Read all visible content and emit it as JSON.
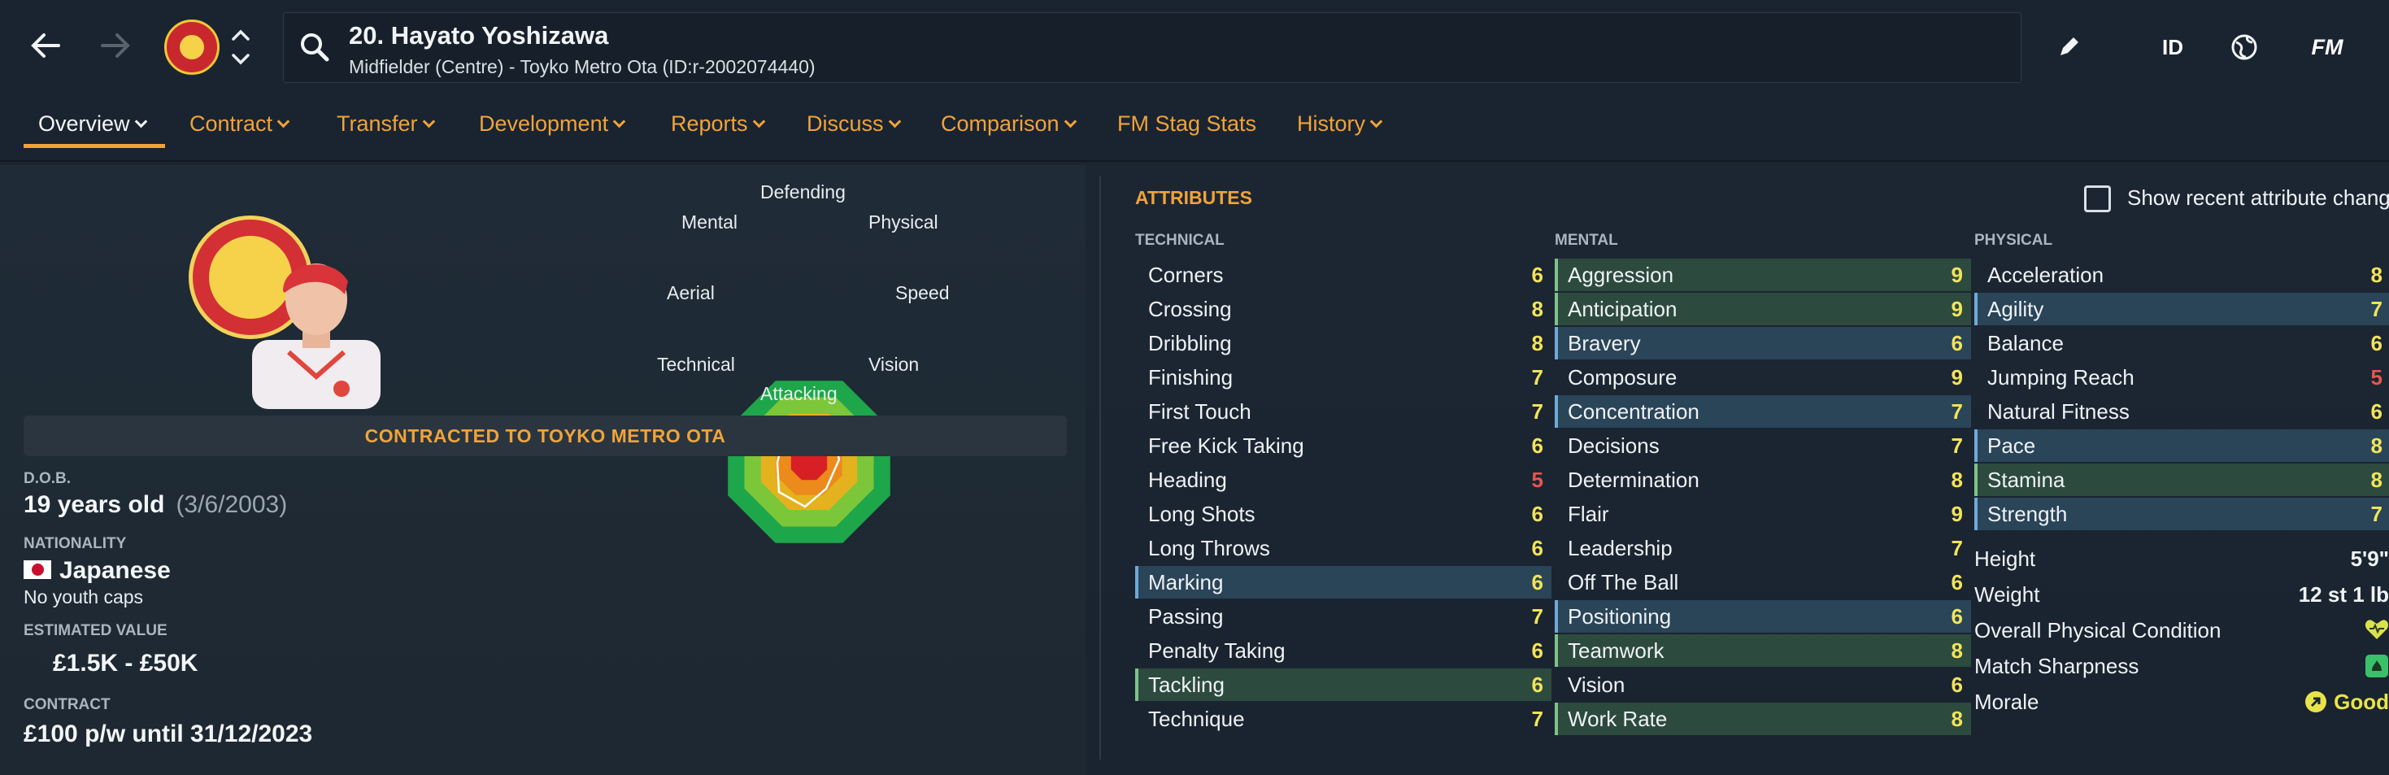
{
  "header": {
    "player_name": "20. Hayato Yoshizawa",
    "player_subtitle": "Midfielder (Centre) - Toyko Metro Ota (ID:r-2002074440)",
    "icon_id": "ID",
    "icon_fm": "FM"
  },
  "tabs": [
    {
      "label": "Overview"
    },
    {
      "label": "Contract"
    },
    {
      "label": "Transfer"
    },
    {
      "label": "Development"
    },
    {
      "label": "Reports"
    },
    {
      "label": "Discuss"
    },
    {
      "label": "Comparison"
    },
    {
      "label": "FM Stag Stats"
    },
    {
      "label": "History"
    }
  ],
  "profile": {
    "contracted_banner": "CONTRACTED TO TOYKO METRO OTA",
    "dob_label": "D.O.B.",
    "age": "19 years old",
    "dob": "(3/6/2003)",
    "nationality_label": "NATIONALITY",
    "nationality": "Japanese",
    "youth_caps": "No youth caps",
    "value_label": "ESTIMATED VALUE",
    "value": "£1.5K - £50K",
    "contract_label": "CONTRACT",
    "contract": "£100 p/w until 31/12/2023"
  },
  "polygon": {
    "labels": {
      "defending": "Defending",
      "physical": "Physical",
      "speed": "Speed",
      "vision": "Vision",
      "attacking": "Attacking",
      "technical": "Technical",
      "aerial": "Aerial",
      "mental": "Mental"
    },
    "ring_colors": [
      "#1ea64a",
      "#7cc63a",
      "#e4b21e",
      "#ec8a1c",
      "#d81f26"
    ]
  },
  "attributes": {
    "title": "ATTRIBUTES",
    "show_recent_label": "Show recent attribute changes",
    "technical_label": "TECHNICAL",
    "mental_label": "MENTAL",
    "physical_label": "PHYSICAL",
    "technical": [
      {
        "name": "Corners",
        "value": "6",
        "hl": ""
      },
      {
        "name": "Crossing",
        "value": "8",
        "hl": ""
      },
      {
        "name": "Dribbling",
        "value": "8",
        "hl": ""
      },
      {
        "name": "Finishing",
        "value": "7",
        "hl": ""
      },
      {
        "name": "First Touch",
        "value": "7",
        "hl": ""
      },
      {
        "name": "Free Kick Taking",
        "value": "6",
        "hl": ""
      },
      {
        "name": "Heading",
        "value": "5",
        "hl": ""
      },
      {
        "name": "Long Shots",
        "value": "6",
        "hl": ""
      },
      {
        "name": "Long Throws",
        "value": "6",
        "hl": ""
      },
      {
        "name": "Marking",
        "value": "6",
        "hl": "blue"
      },
      {
        "name": "Passing",
        "value": "7",
        "hl": ""
      },
      {
        "name": "Penalty Taking",
        "value": "6",
        "hl": ""
      },
      {
        "name": "Tackling",
        "value": "6",
        "hl": "green"
      },
      {
        "name": "Technique",
        "value": "7",
        "hl": ""
      }
    ],
    "mental": [
      {
        "name": "Aggression",
        "value": "9",
        "hl": "green"
      },
      {
        "name": "Anticipation",
        "value": "9",
        "hl": "green"
      },
      {
        "name": "Bravery",
        "value": "6",
        "hl": "blue"
      },
      {
        "name": "Composure",
        "value": "9",
        "hl": ""
      },
      {
        "name": "Concentration",
        "value": "7",
        "hl": "blue"
      },
      {
        "name": "Decisions",
        "value": "7",
        "hl": ""
      },
      {
        "name": "Determination",
        "value": "8",
        "hl": ""
      },
      {
        "name": "Flair",
        "value": "9",
        "hl": ""
      },
      {
        "name": "Leadership",
        "value": "7",
        "hl": ""
      },
      {
        "name": "Off The Ball",
        "value": "6",
        "hl": ""
      },
      {
        "name": "Positioning",
        "value": "6",
        "hl": "blue"
      },
      {
        "name": "Teamwork",
        "value": "8",
        "hl": "green"
      },
      {
        "name": "Vision",
        "value": "6",
        "hl": ""
      },
      {
        "name": "Work Rate",
        "value": "8",
        "hl": "green"
      }
    ],
    "physical": [
      {
        "name": "Acceleration",
        "value": "8",
        "hl": ""
      },
      {
        "name": "Agility",
        "value": "7",
        "hl": "blue"
      },
      {
        "name": "Balance",
        "value": "6",
        "hl": ""
      },
      {
        "name": "Jumping Reach",
        "value": "5",
        "hl": ""
      },
      {
        "name": "Natural Fitness",
        "value": "6",
        "hl": ""
      },
      {
        "name": "Pace",
        "value": "8",
        "hl": "blue"
      },
      {
        "name": "Stamina",
        "value": "8",
        "hl": "green"
      },
      {
        "name": "Strength",
        "value": "7",
        "hl": "blue"
      }
    ],
    "info": {
      "height_label": "Height",
      "height": "5'9\"",
      "weight_label": "Weight",
      "weight": "12 st 1 lb",
      "condition_label": "Overall Physical Condition",
      "sharpness_label": "Match Sharpness",
      "morale_label": "Morale",
      "morale": "Good"
    }
  }
}
